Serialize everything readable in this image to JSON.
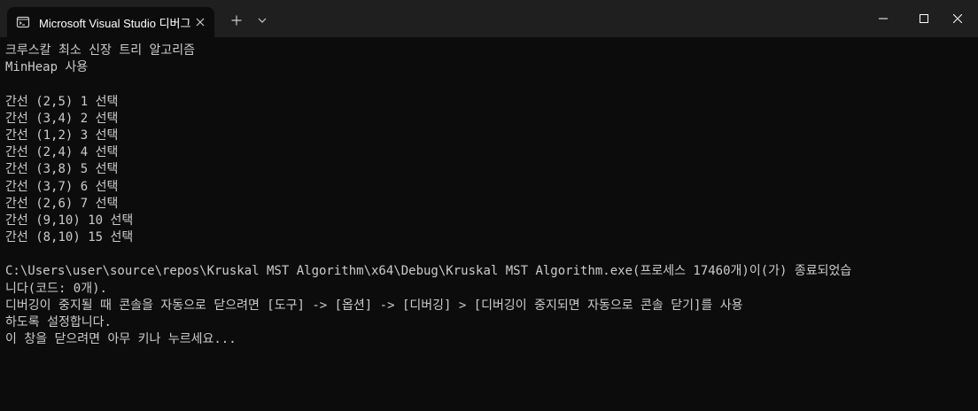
{
  "window": {
    "tab_title": "Microsoft Visual Studio 디버그",
    "icon": "terminal-icon"
  },
  "console": {
    "title_line": "크루스칼 최소 신장 트리 알고리즘",
    "heap_line": "MinHeap 사용",
    "edges": [
      "간선 (2,5) 1 선택",
      "간선 (3,4) 2 선택",
      "간선 (1,2) 3 선택",
      "간선 (2,4) 4 선택",
      "간선 (3,8) 5 선택",
      "간선 (3,7) 6 선택",
      "간선 (2,6) 7 선택",
      "간선 (9,10) 10 선택",
      "간선 (8,10) 15 선택"
    ],
    "exit_line_1": "C:\\Users\\user\\source\\repos\\Kruskal MST Algorithm\\x64\\Debug\\Kruskal MST Algorithm.exe(프로세스 17460개)이(가) 종료되었습",
    "exit_line_2": "니다(코드: 0개).",
    "hint_line_1": "디버깅이 중지될 때 콘솔을 자동으로 닫으려면 [도구] -> [옵션] -> [디버깅] > [디버깅이 중지되면 자동으로 콘솔 닫기]를 사용",
    "hint_line_2": "하도록 설정합니다.",
    "press_key_line": "이 창을 닫으려면 아무 키나 누르세요..."
  }
}
